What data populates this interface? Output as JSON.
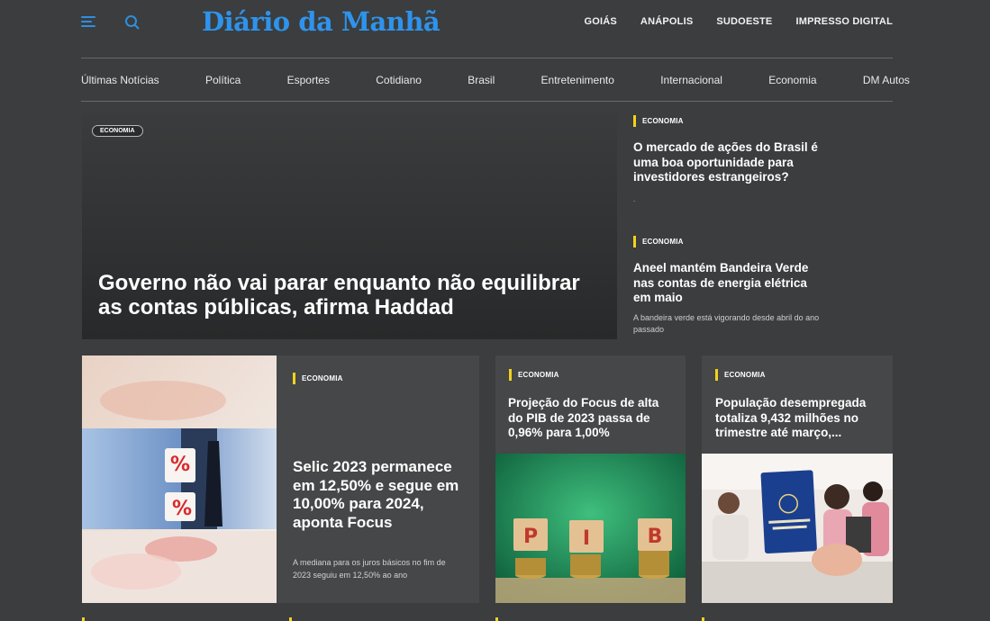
{
  "brand": {
    "logo_text": "Diário da Manhã"
  },
  "top_links": [
    "GOIÁS",
    "ANÁPOLIS",
    "SUDOESTE",
    "IMPRESSO DIGITAL"
  ],
  "nav": [
    "Últimas Notícias",
    "Política",
    "Esportes",
    "Cotidiano",
    "Brasil",
    "Entretenimento",
    "Internacional",
    "Economia",
    "DM Autos"
  ],
  "hero": {
    "category": "ECONOMIA",
    "title": "Governo não vai parar enquanto não equilibrar as contas públicas, afirma Haddad"
  },
  "side_stories": [
    {
      "category": "ECONOMIA",
      "title": "O mercado de ações do Brasil é uma boa oportunidade para investidores estrangeiros?",
      "desc": "."
    },
    {
      "category": "ECONOMIA",
      "title": "Aneel mantém Bandeira Verde nas contas de energia elétrica em maio",
      "desc": "A bandeira verde está vigorando desde abril do ano passado"
    }
  ],
  "cards": {
    "selic": {
      "category": "ECONOMIA",
      "title": "Selic 2023 permanece em 12,50% e segue em 10,00% para 2024, aponta Focus",
      "desc": "A mediana para os juros básicos no fim de 2023 seguiu em 12,50% ao ano"
    },
    "pib": {
      "category": "ECONOMIA",
      "title": "Projeção do Focus de alta do PIB de 2023 passa de 0,96% para 1,00%",
      "image_letters": [
        "P",
        "I",
        "B"
      ]
    },
    "desemprego": {
      "category": "ECONOMIA",
      "title": "População desempregada totaliza 9,432 milhões no trimestre até março,..."
    }
  },
  "colors": {
    "accent_blue": "#2e93ec",
    "tag_yellow": "#f2d21e",
    "background": "#3b3d3e",
    "card": "#454748"
  }
}
